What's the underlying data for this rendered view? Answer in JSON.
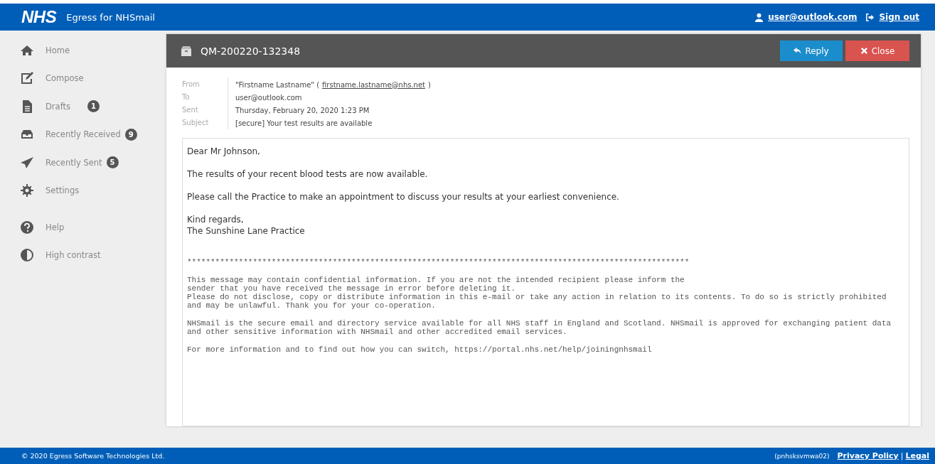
{
  "header": {
    "logo": "NHS",
    "app_name": "Egress for NHSmail",
    "user": "user@outlook.com",
    "sign_out": "Sign out"
  },
  "sidebar": {
    "items": [
      {
        "kind": "home",
        "label": "Home"
      },
      {
        "kind": "compose",
        "label": "Compose"
      },
      {
        "kind": "drafts",
        "label": "Drafts",
        "badge": "1"
      },
      {
        "kind": "received",
        "label": "Recently Received",
        "badge": "9"
      },
      {
        "kind": "sent",
        "label": "Recently Sent",
        "badge": "5"
      },
      {
        "kind": "settings",
        "label": "Settings"
      },
      {
        "kind": "help",
        "label": "Help"
      },
      {
        "kind": "contrast",
        "label": "High contrast"
      }
    ]
  },
  "message": {
    "title": "QM-200220-132348",
    "buttons": [
      {
        "kind": "reply",
        "label": "Reply"
      },
      {
        "kind": "close",
        "label": "Close"
      }
    ],
    "fields": [
      {
        "label": "From",
        "name": "\"Firstname Lastname\" (",
        "email": "firstname.lastname@nhs.net",
        "close": ")"
      },
      {
        "label": "To",
        "value": "user@outlook.com"
      },
      {
        "label": "Sent",
        "value": "Thursday, February 20, 2020 1:23 PM"
      },
      {
        "label": "Subject",
        "value": "[secure] Your test results are available"
      }
    ],
    "body": [
      "Dear Mr Johnson,",
      "The results of your recent blood tests are now available.",
      "Please call the Practice to make an appointment to discuss your results at your earliest convenience.",
      "Kind regards,\nThe Sunshine Lane Practice"
    ],
    "disclaimer": [
      "***********************************************************************************************************",
      "This message may contain confidential information. If you are not the intended recipient please inform the\nsender that you have received the message in error before deleting it.\nPlease do not disclose, copy or distribute information in this e-mail or take any action in relation to its contents. To do so is strictly prohibited\nand may be unlawful. Thank you for your co-operation.",
      "NHSmail is the secure email and directory service available for all NHS staff in England and Scotland. NHSmail is approved for exchanging patient data\nand other sensitive information with NHSmail and other accredited email services.",
      "For more information and to find out how you can switch, https://portal.nhs.net/help/joiningnhsmail"
    ]
  },
  "footer": {
    "copyright": "© 2020 Egress Software Technologies Ltd.",
    "server": "(pnhsksvmwa02)",
    "links": [
      "Privacy Policy",
      "Legal"
    ],
    "separator": "|"
  }
}
